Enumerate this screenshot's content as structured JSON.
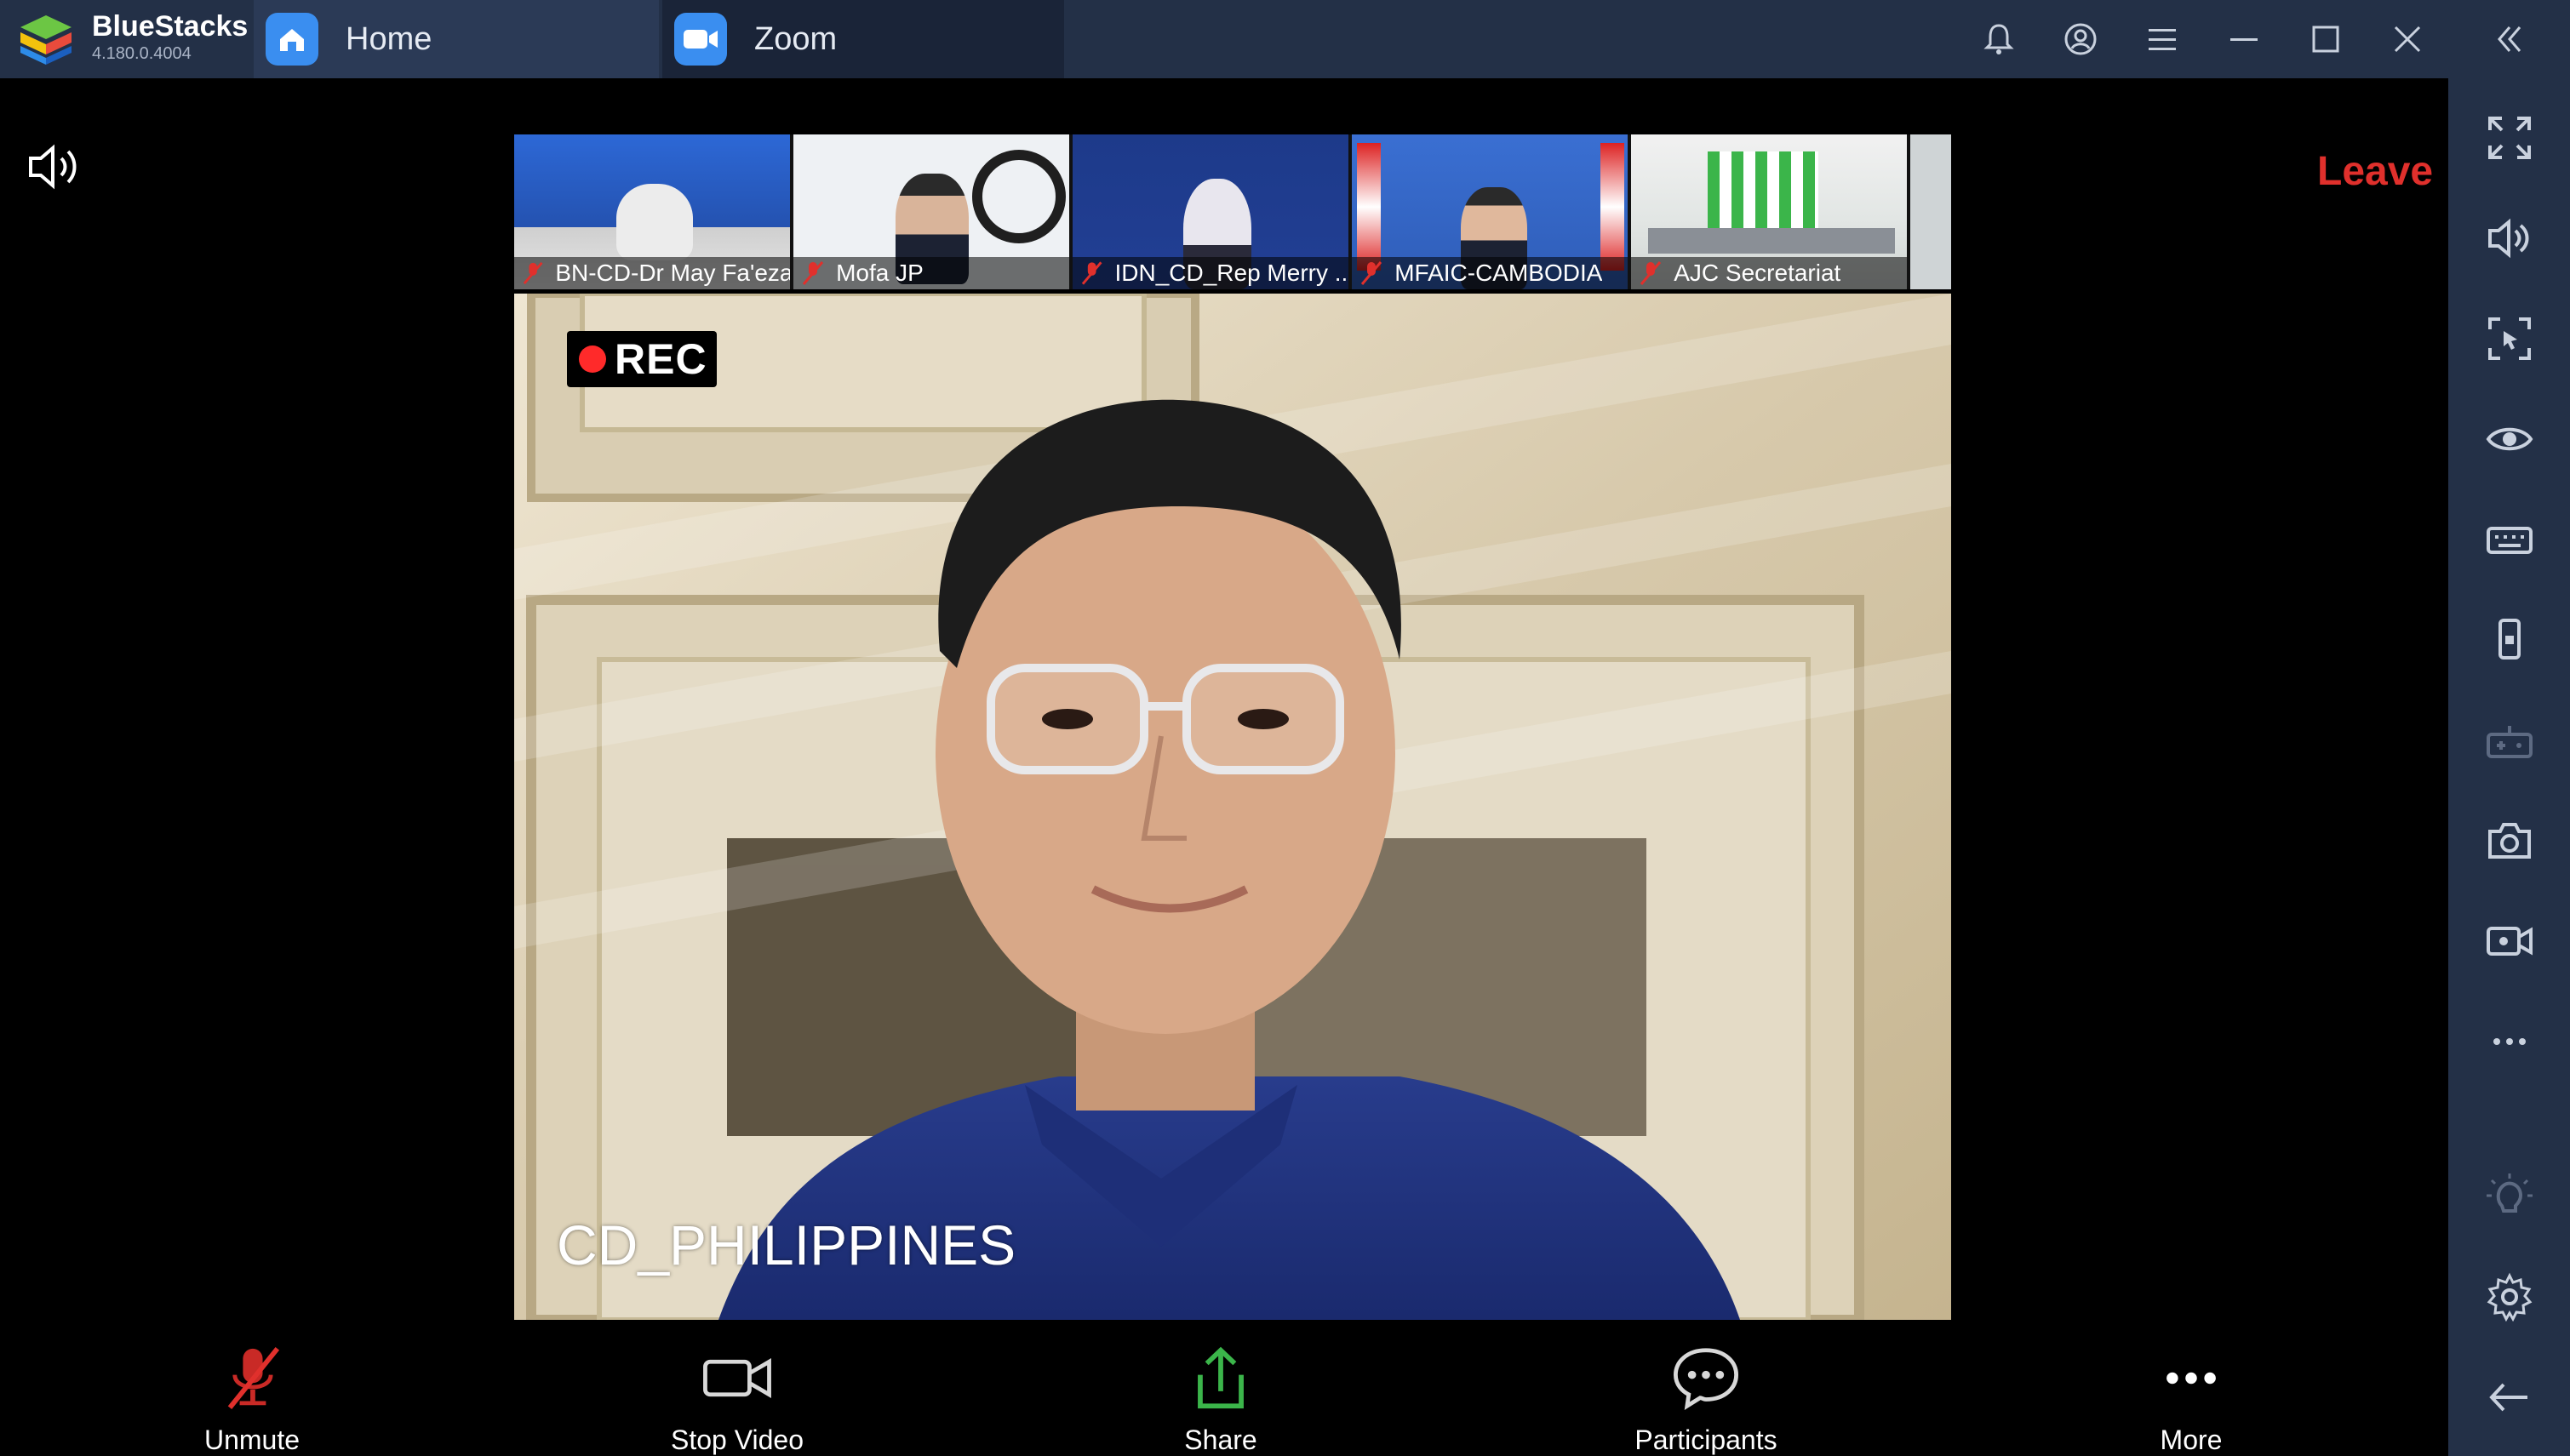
{
  "window": {
    "app_name": "BlueStacks",
    "version": "4.180.0.4004",
    "tabs": [
      {
        "label": "Home",
        "icon": "home-icon"
      },
      {
        "label": "Zoom",
        "icon": "zoom-camera-icon"
      }
    ],
    "title_icons": [
      "bell-icon",
      "account-icon",
      "menu-icon",
      "minimize-icon",
      "maximize-icon",
      "close-icon",
      "collapse-sidebar-icon"
    ]
  },
  "sidebar": {
    "icons": [
      "fullscreen-icon",
      "volume-icon",
      "cursor-lock-icon",
      "eye-icon",
      "keyboard-icon",
      "phone-rotate-icon",
      "gamepad-icon",
      "camera-icon",
      "video-record-icon",
      "more-icon",
      "brightness-icon",
      "settings-icon",
      "back-icon"
    ]
  },
  "meeting": {
    "leave_label": "Leave",
    "rec_label": "REC",
    "speaker_name": "CD_PHILIPPINES",
    "participants_strip": [
      {
        "name": "BN-CD-Dr May Fa'ezah",
        "bg": "#2a5fc4"
      },
      {
        "name": "Mofa JP",
        "bg": "#e9eef4"
      },
      {
        "name": "IDN_CD_Rep Merry ...",
        "bg": "#1d3a8a"
      },
      {
        "name": "MFAIC-CAMBODIA",
        "bg": "#3566c8"
      },
      {
        "name": "AJC Secretariat",
        "bg": "#dfe6e2"
      }
    ]
  },
  "toolbar": {
    "items": [
      {
        "label": "Unmute",
        "icon": "muted-mic-icon"
      },
      {
        "label": "Stop Video",
        "icon": "video-camera-icon"
      },
      {
        "label": "Share",
        "icon": "share-icon"
      },
      {
        "label": "Participants",
        "icon": "chat-bubble-icon"
      },
      {
        "label": "More",
        "icon": "more-dots-icon"
      }
    ]
  },
  "colors": {
    "chrome": "#233047",
    "leave": "#e0302c",
    "share": "#3bb54a",
    "muted": "#e0302c"
  }
}
